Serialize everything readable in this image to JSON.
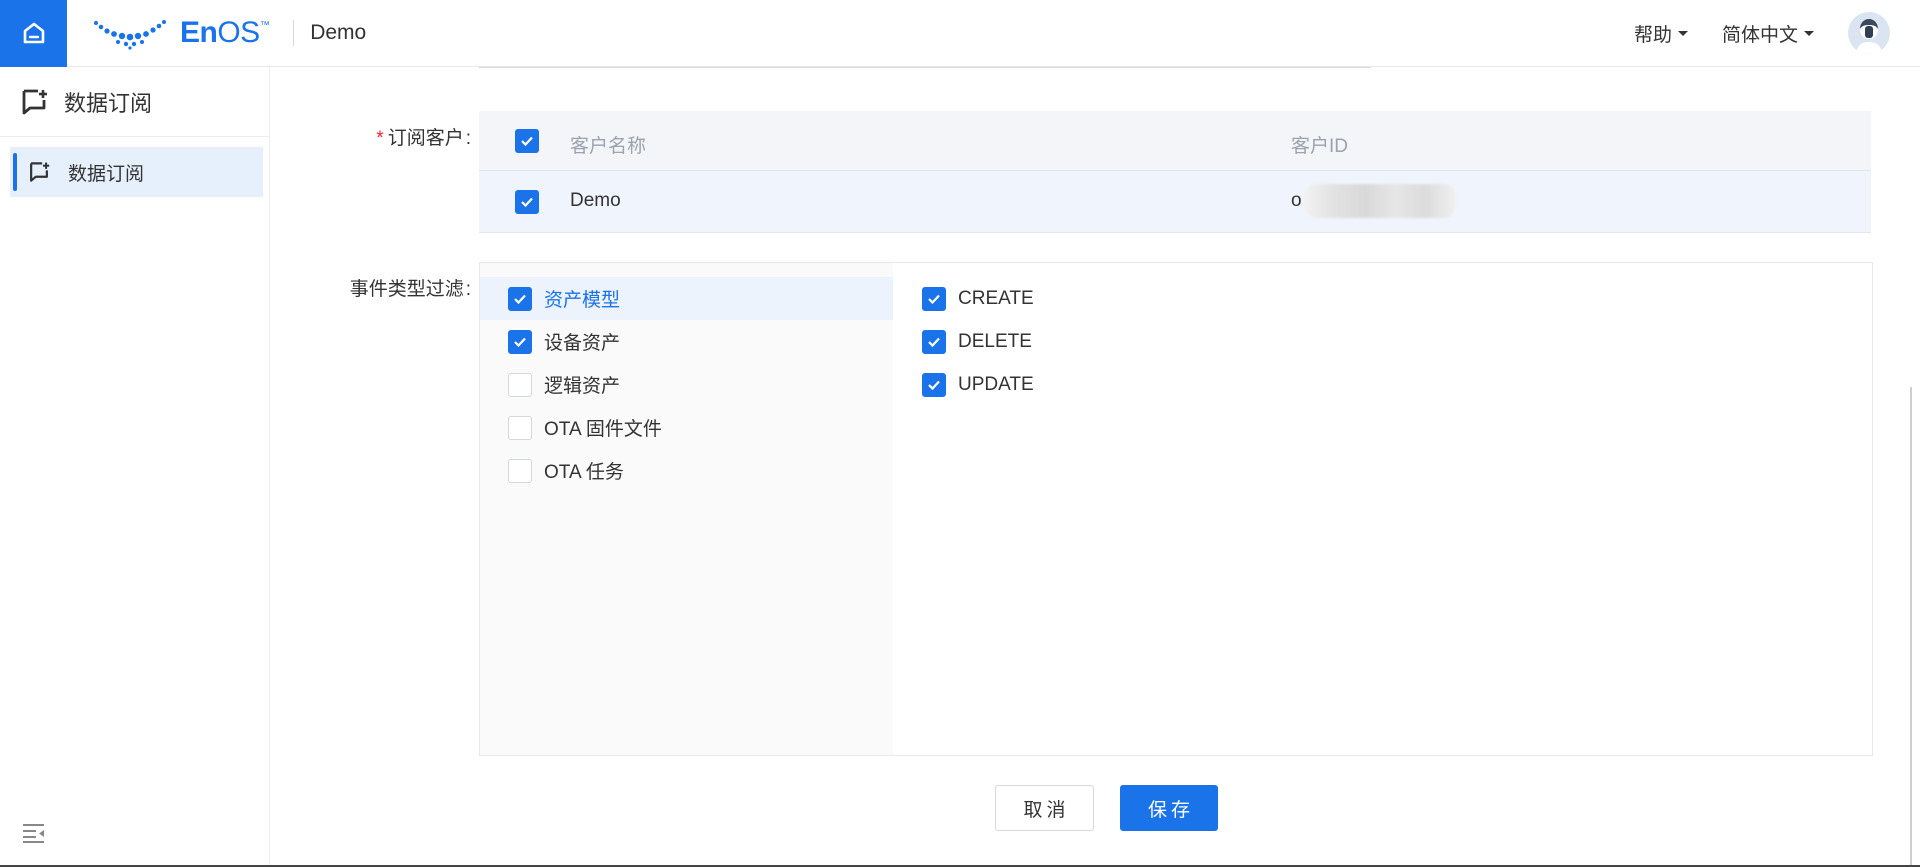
{
  "header": {
    "logo_text_bold": "En",
    "logo_text_light": "OS",
    "logo_tm": "™",
    "app_name": "Demo",
    "help_label": "帮助",
    "language_label": "简体中文"
  },
  "sidebar": {
    "title": "数据订阅",
    "items": [
      {
        "label": "数据订阅",
        "active": true
      }
    ]
  },
  "form": {
    "customer_label": "订阅客户",
    "required_mark": "*",
    "label_suffix": ":",
    "customer_table": {
      "columns": [
        "客户名称",
        "客户ID"
      ],
      "rows": [
        {
          "name": "Demo",
          "id_visible_prefix": "o",
          "checked": true
        }
      ],
      "select_all_checked": true
    },
    "event_filter_label": "事件类型过滤",
    "event_categories": [
      {
        "label": "资产模型",
        "checked": true,
        "selected": true
      },
      {
        "label": "设备资产",
        "checked": true,
        "selected": false
      },
      {
        "label": "逻辑资产",
        "checked": false,
        "selected": false
      },
      {
        "label": "OTA 固件文件",
        "checked": false,
        "selected": false
      },
      {
        "label": "OTA 任务",
        "checked": false,
        "selected": false
      }
    ],
    "event_operations": [
      {
        "label": "CREATE",
        "checked": true
      },
      {
        "label": "DELETE",
        "checked": true
      },
      {
        "label": "UPDATE",
        "checked": true
      }
    ],
    "cancel_label": "取消",
    "save_label": "保存"
  },
  "colors": {
    "accent": "#1a73e8",
    "required": "#f5222d",
    "selected_bg": "#ecf3fd"
  }
}
